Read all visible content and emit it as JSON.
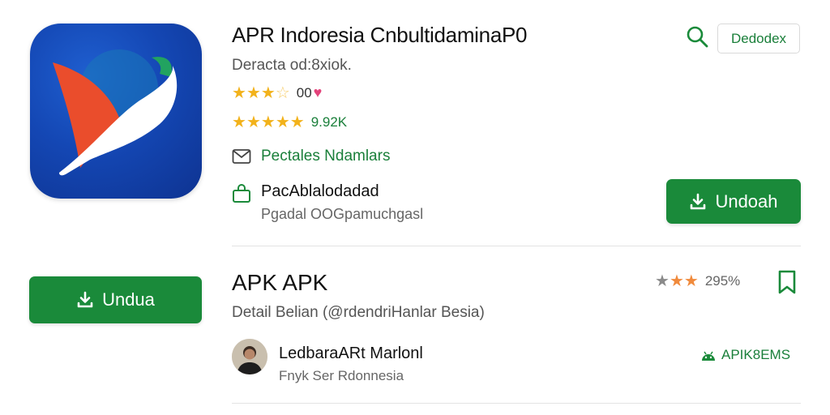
{
  "app": {
    "title": "APR Indoresia CnbultidaminaP0",
    "subtitle": "Deracta od:8xiok."
  },
  "rating_row1": {
    "stars_filled": 3,
    "stars_half": 1,
    "value": "00"
  },
  "rating_row2": {
    "stars_filled": 5,
    "value": "9.92K"
  },
  "mail_row": {
    "label": "Pectales Ndamlars"
  },
  "bag_row": {
    "line1": "PacAblalodadad",
    "line2": "Pgadal OOGpamuchgasl"
  },
  "header_chip": {
    "label": "Dedodex"
  },
  "install_button": {
    "label": "Undoah"
  },
  "second_item": {
    "title": "APK APK",
    "detail": "Detail Belian (@rdendriHanlar Besia)",
    "rating_value": "295%",
    "developer_name": "LedbaraARt Marlonl",
    "developer_sub": "Fnyk Ser Rdonnesia",
    "badge": "APIK8EMS"
  },
  "left_button": {
    "label": "Undua"
  },
  "colors": {
    "accent": "#1a8a3a",
    "star": "#f2b21b",
    "icon_bg": "#1447b4"
  },
  "icons": [
    "search-icon",
    "mail-icon",
    "shopping-bag-icon",
    "download-icon",
    "bookmark-icon",
    "android-icon",
    "heart-icon",
    "star-icon"
  ]
}
